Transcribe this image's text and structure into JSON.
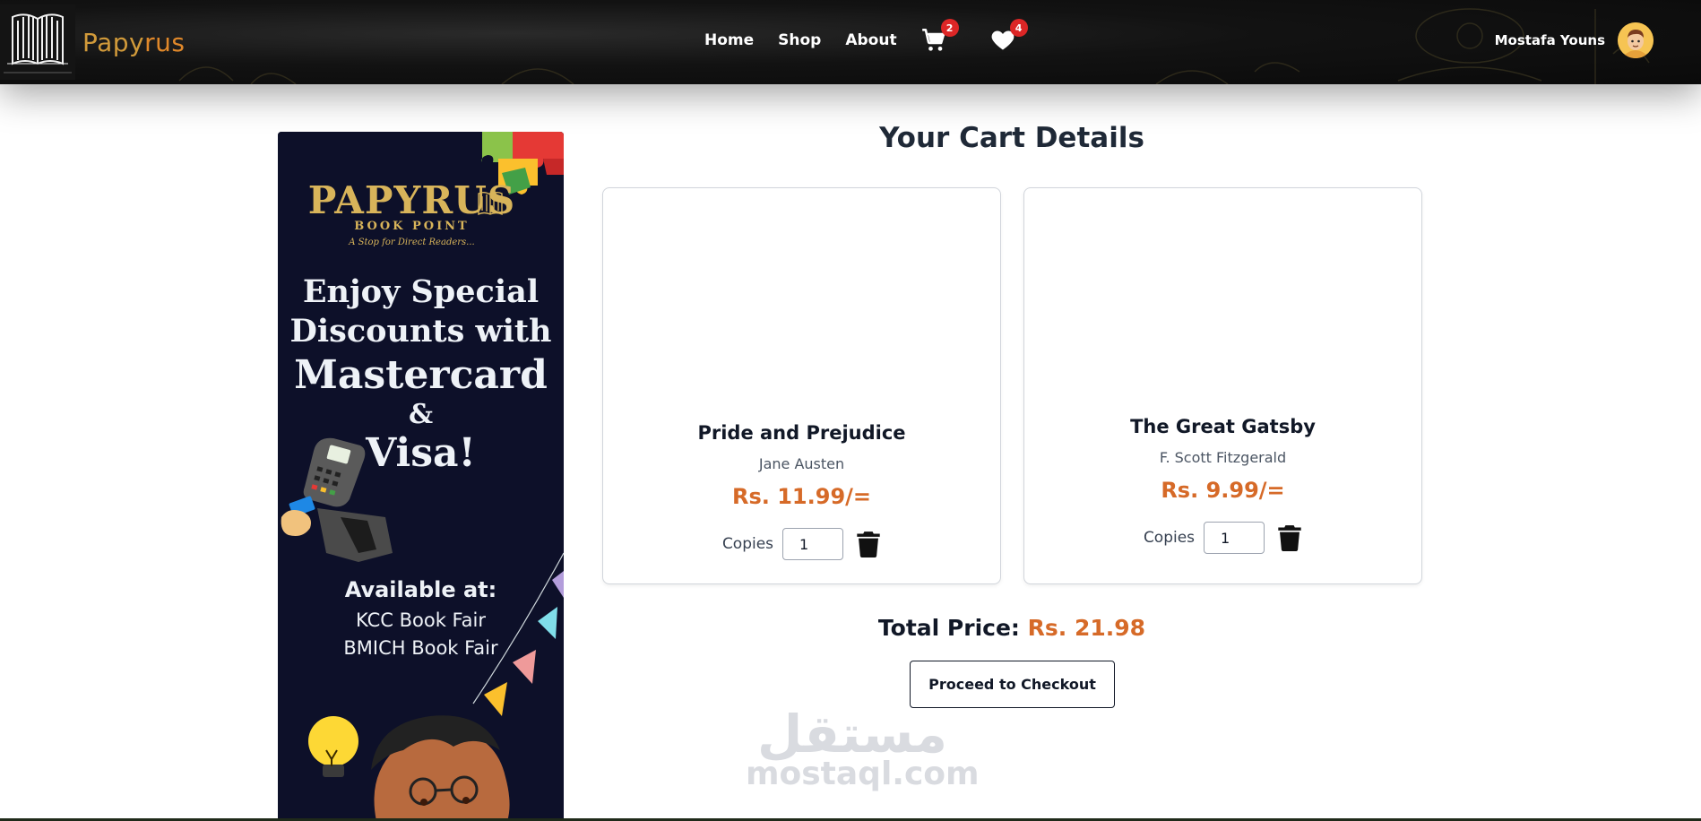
{
  "brand": {
    "name_part1": "Papy",
    "name_part2": "rus",
    "logo_icon": "open-book-logo"
  },
  "nav": {
    "links": [
      "Home",
      "Shop",
      "About"
    ],
    "cart_count": "2",
    "wishlist_count": "4",
    "cart_icon": "cart-icon",
    "wishlist_icon": "heart-icon"
  },
  "user": {
    "name": "Mostafa Youns",
    "avatar_icon": "avatar"
  },
  "banner": {
    "brand": "PAPYRUS",
    "subtitle": "BOOK POINT",
    "tagline": "A Stop for Direct Readers...",
    "headline": [
      "Enjoy Special",
      "Discounts with",
      "Mastercard",
      "&",
      "Visa!"
    ],
    "available_label": "Available at:",
    "locations": [
      "KCC Book Fair",
      "BMICH Book Fair"
    ]
  },
  "cart": {
    "title": "Your Cart Details",
    "copies_label": "Copies",
    "items": [
      {
        "title": "Pride and Prejudice",
        "author": "Jane Austen",
        "price": "Rs. 11.99/=",
        "copies": "1"
      },
      {
        "title": "The Great Gatsby",
        "author": "F. Scott Fitzgerald",
        "price": "Rs. 9.99/=",
        "copies": "1"
      }
    ],
    "total_label": "Total Price:",
    "total_value": "Rs. 21.98",
    "checkout_label": "Proceed to Checkout"
  },
  "watermark": {
    "arabic": "مستقل",
    "latin": "mostaql.com"
  },
  "colors": {
    "accent": "#d66a28",
    "brand_gold": "#d19a3a",
    "badge": "#dc2626",
    "navbar": "#121212",
    "banner_bg": "#0d1029"
  }
}
